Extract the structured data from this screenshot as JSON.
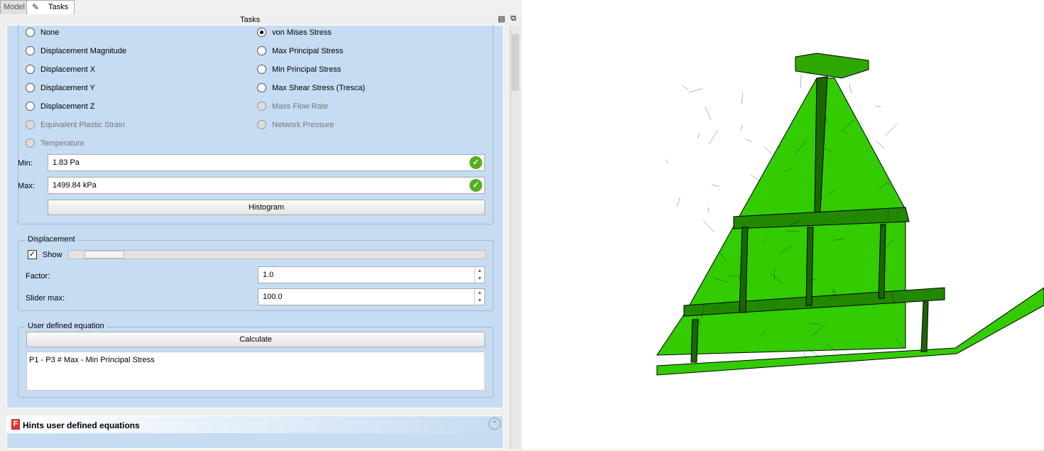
{
  "tabs": {
    "model": "Model",
    "tasks": "Tasks"
  },
  "panel_title": "Tasks",
  "results": {
    "left": [
      {
        "label": "None",
        "checked": false,
        "enabled": true
      },
      {
        "label": "Displacement Magnitude",
        "checked": false,
        "enabled": true
      },
      {
        "label": "Displacement X",
        "checked": false,
        "enabled": true
      },
      {
        "label": "Displacement Y",
        "checked": false,
        "enabled": true
      },
      {
        "label": "Displacement Z",
        "checked": false,
        "enabled": true
      },
      {
        "label": "Equivalent Plastic Strain",
        "checked": false,
        "enabled": false
      },
      {
        "label": "Temperature",
        "checked": false,
        "enabled": false
      }
    ],
    "right": [
      {
        "label": "von Mises Stress",
        "checked": true,
        "enabled": true
      },
      {
        "label": "Max Principal Stress",
        "checked": false,
        "enabled": true
      },
      {
        "label": "Min Principal Stress",
        "checked": false,
        "enabled": true
      },
      {
        "label": "Max Shear Stress (Tresca)",
        "checked": false,
        "enabled": true
      },
      {
        "label": "Mass Flow Rate",
        "checked": false,
        "enabled": false
      },
      {
        "label": "Network Pressure",
        "checked": false,
        "enabled": false
      }
    ],
    "min_label": "Min:",
    "min_value": "1.83 Pa",
    "max_label": "Max:",
    "max_value": "1499.84 kPa",
    "histogram": "Histogram"
  },
  "displacement": {
    "title": "Displacement",
    "show_label": "Show",
    "show_checked": true,
    "slider_fraction": 0.1,
    "factor_label": "Factor:",
    "factor_value": "1.0",
    "slider_max_label": "Slider max:",
    "slider_max_value": "100.0"
  },
  "equation": {
    "title": "User defined equation",
    "calculate": "Calculate",
    "text": "P1 - P3 # Max - Min Principal Stress"
  },
  "hints": {
    "title": "Hints user defined equations"
  },
  "colors": {
    "mesh": "#33cc00",
    "panel": "#c6dcf2"
  }
}
